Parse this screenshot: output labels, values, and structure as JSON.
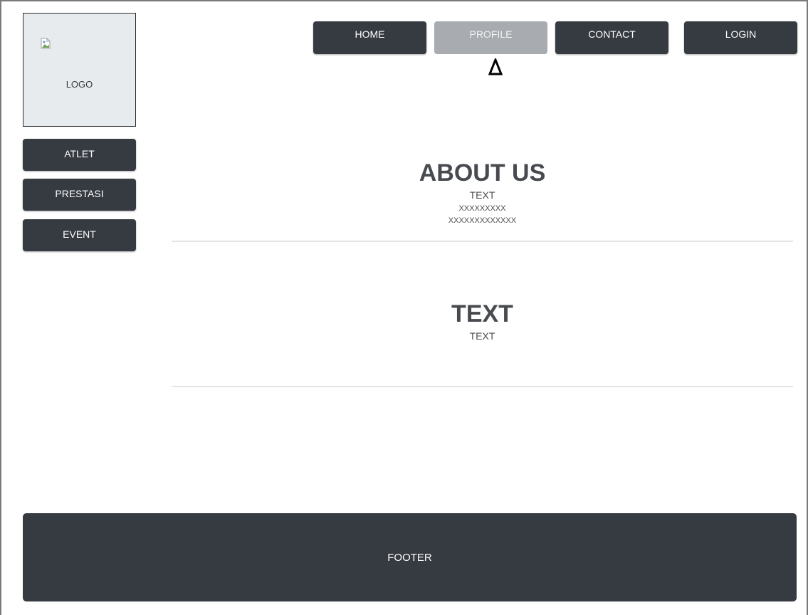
{
  "logo": {
    "text": "LOGO"
  },
  "nav": {
    "items": [
      {
        "label": "HOME"
      },
      {
        "label": "PROFILE",
        "active": true
      },
      {
        "label": "CONTACT"
      },
      {
        "label": "LOGIN"
      }
    ]
  },
  "sidebar": {
    "items": [
      {
        "label": "ATLET"
      },
      {
        "label": "PRESTASI"
      },
      {
        "label": "EVENT"
      }
    ]
  },
  "about": {
    "title": "ABOUT US",
    "line1": "TEXT",
    "line2": "XXXXXXXXX",
    "line3": "XXXXXXXXXXXXX"
  },
  "second": {
    "title": "TEXT",
    "subtitle": "TEXT"
  },
  "footer": {
    "text": "FOOTER"
  },
  "colors": {
    "button_bg": "#363a41",
    "active_button_bg": "#a8abaf",
    "footer_bg": "#363a41",
    "logo_bg": "#e8ebee"
  }
}
